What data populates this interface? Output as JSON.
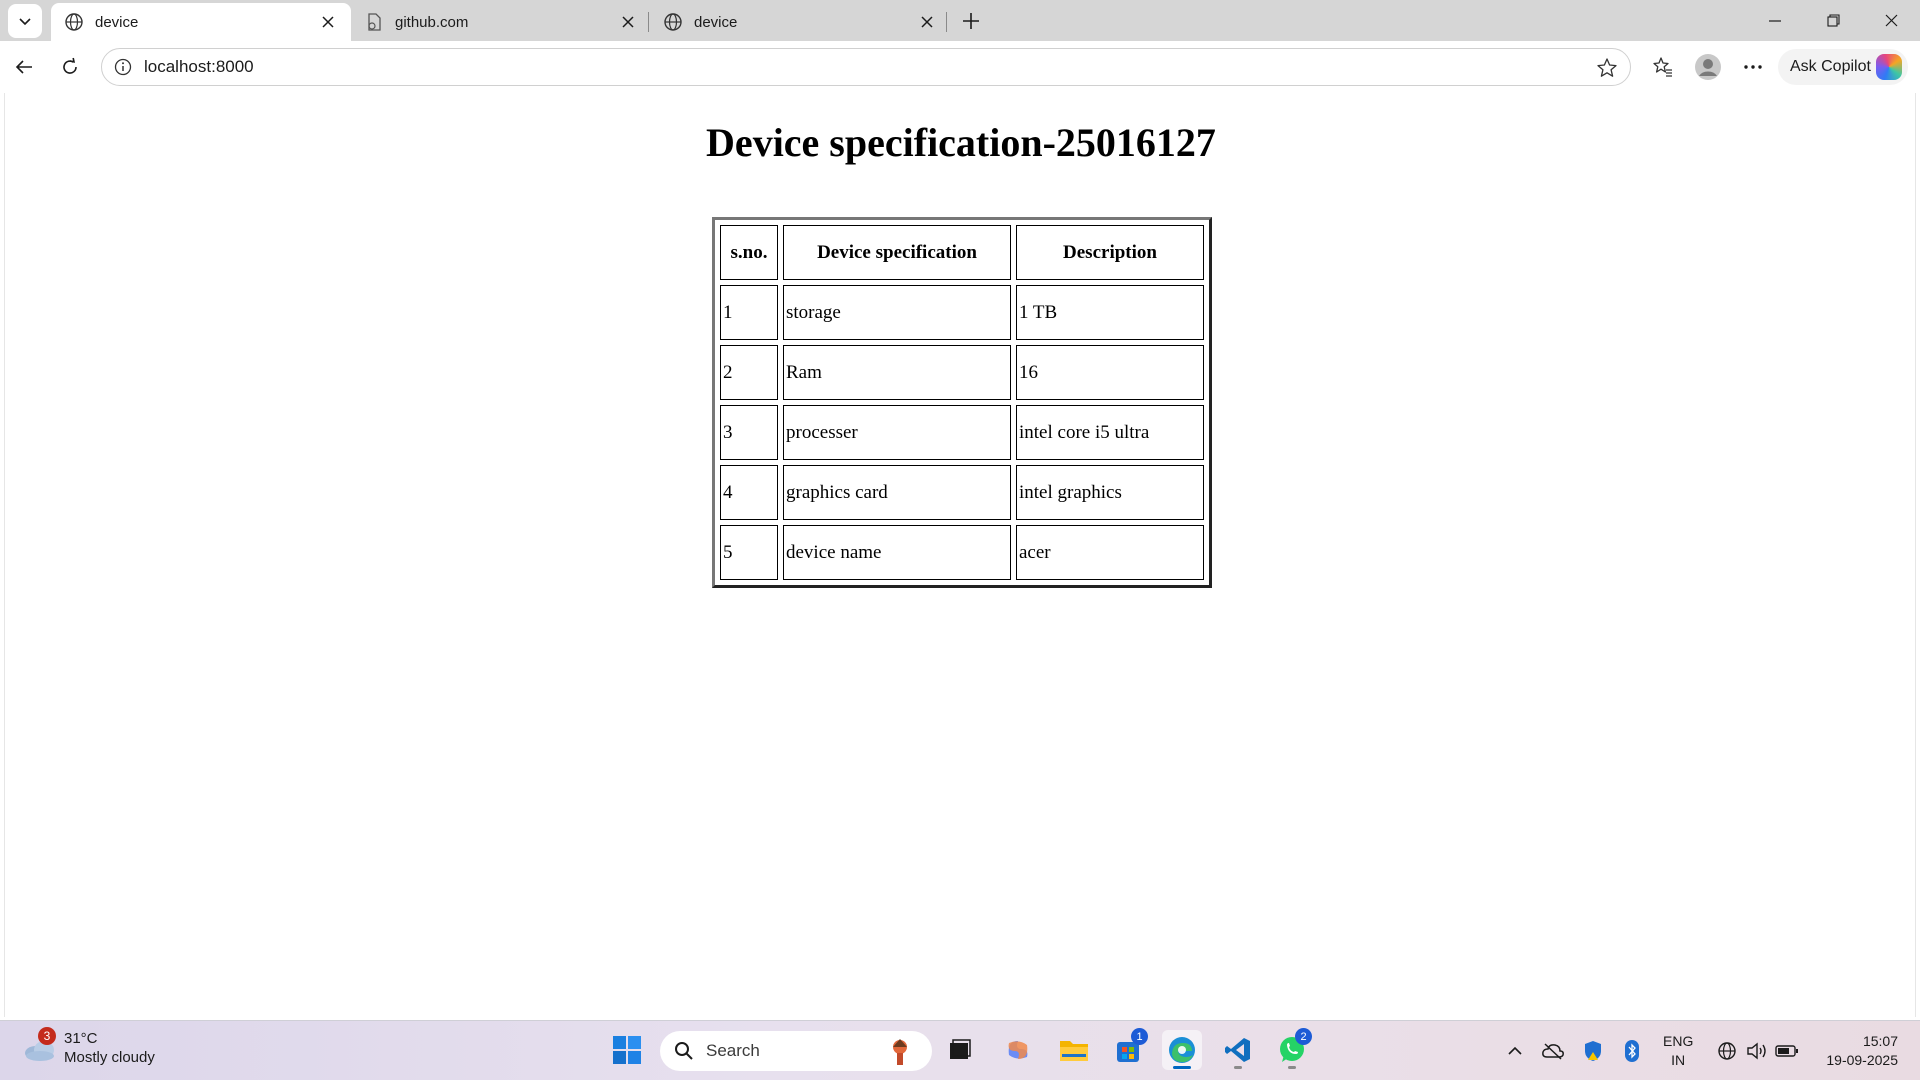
{
  "browser": {
    "tabs": [
      {
        "title": "device",
        "icon": "globe-icon",
        "active": true
      },
      {
        "title": "github.com",
        "icon": "page-icon",
        "active": false
      },
      {
        "title": "device",
        "icon": "globe-icon",
        "active": false
      }
    ],
    "address": "localhost:8000",
    "copilot_label": "Ask Copilot"
  },
  "page": {
    "title": "Device specification-25016127",
    "table": {
      "headers": [
        "s.no.",
        "Device specification",
        "Description"
      ],
      "rows": [
        [
          "1",
          "storage",
          "1 TB"
        ],
        [
          "2",
          "Ram",
          "16"
        ],
        [
          "3",
          "processer",
          "intel core i5 ultra"
        ],
        [
          "4",
          "graphics card",
          "intel graphics"
        ],
        [
          "5",
          "device name",
          "acer"
        ]
      ]
    }
  },
  "taskbar": {
    "weather": {
      "temp": "31°C",
      "condition": "Mostly cloudy",
      "badge": "3"
    },
    "search_label": "Search",
    "store_badge": "1",
    "whatsapp_badge": "2",
    "language": {
      "line1": "ENG",
      "line2": "IN"
    },
    "time": "15:07",
    "date": "19-09-2025"
  }
}
